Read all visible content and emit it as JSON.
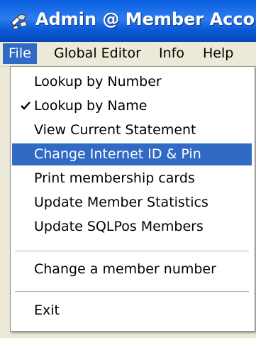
{
  "window": {
    "title": "Admin @ Member Accour"
  },
  "menubar": {
    "items": [
      {
        "label": "File"
      },
      {
        "label": "Global Editor"
      },
      {
        "label": "Info"
      },
      {
        "label": "Help"
      }
    ]
  },
  "file_menu": {
    "items": [
      {
        "label": "Lookup by Number",
        "checked": false,
        "highlighted": false
      },
      {
        "label": "Lookup by Name",
        "checked": true,
        "highlighted": false
      },
      {
        "label": "View Current Statement",
        "checked": false,
        "highlighted": false
      },
      {
        "label": "Change Internet ID & Pin",
        "checked": false,
        "highlighted": true
      },
      {
        "label": "Print membership cards",
        "checked": false,
        "highlighted": false
      },
      {
        "label": "Update Member Statistics",
        "checked": false,
        "highlighted": false
      },
      {
        "label": "Update SQLPos Members",
        "checked": false,
        "highlighted": false
      },
      {
        "label": "Change a member number",
        "checked": false,
        "highlighted": false
      },
      {
        "label": "Exit",
        "checked": false,
        "highlighted": false
      }
    ]
  },
  "colors": {
    "titlebar": "#0a5fe0",
    "highlight": "#316ac5",
    "menu_bg": "#ece9d8"
  },
  "icons": {
    "app": "key-icon",
    "check": "checkmark-icon"
  }
}
